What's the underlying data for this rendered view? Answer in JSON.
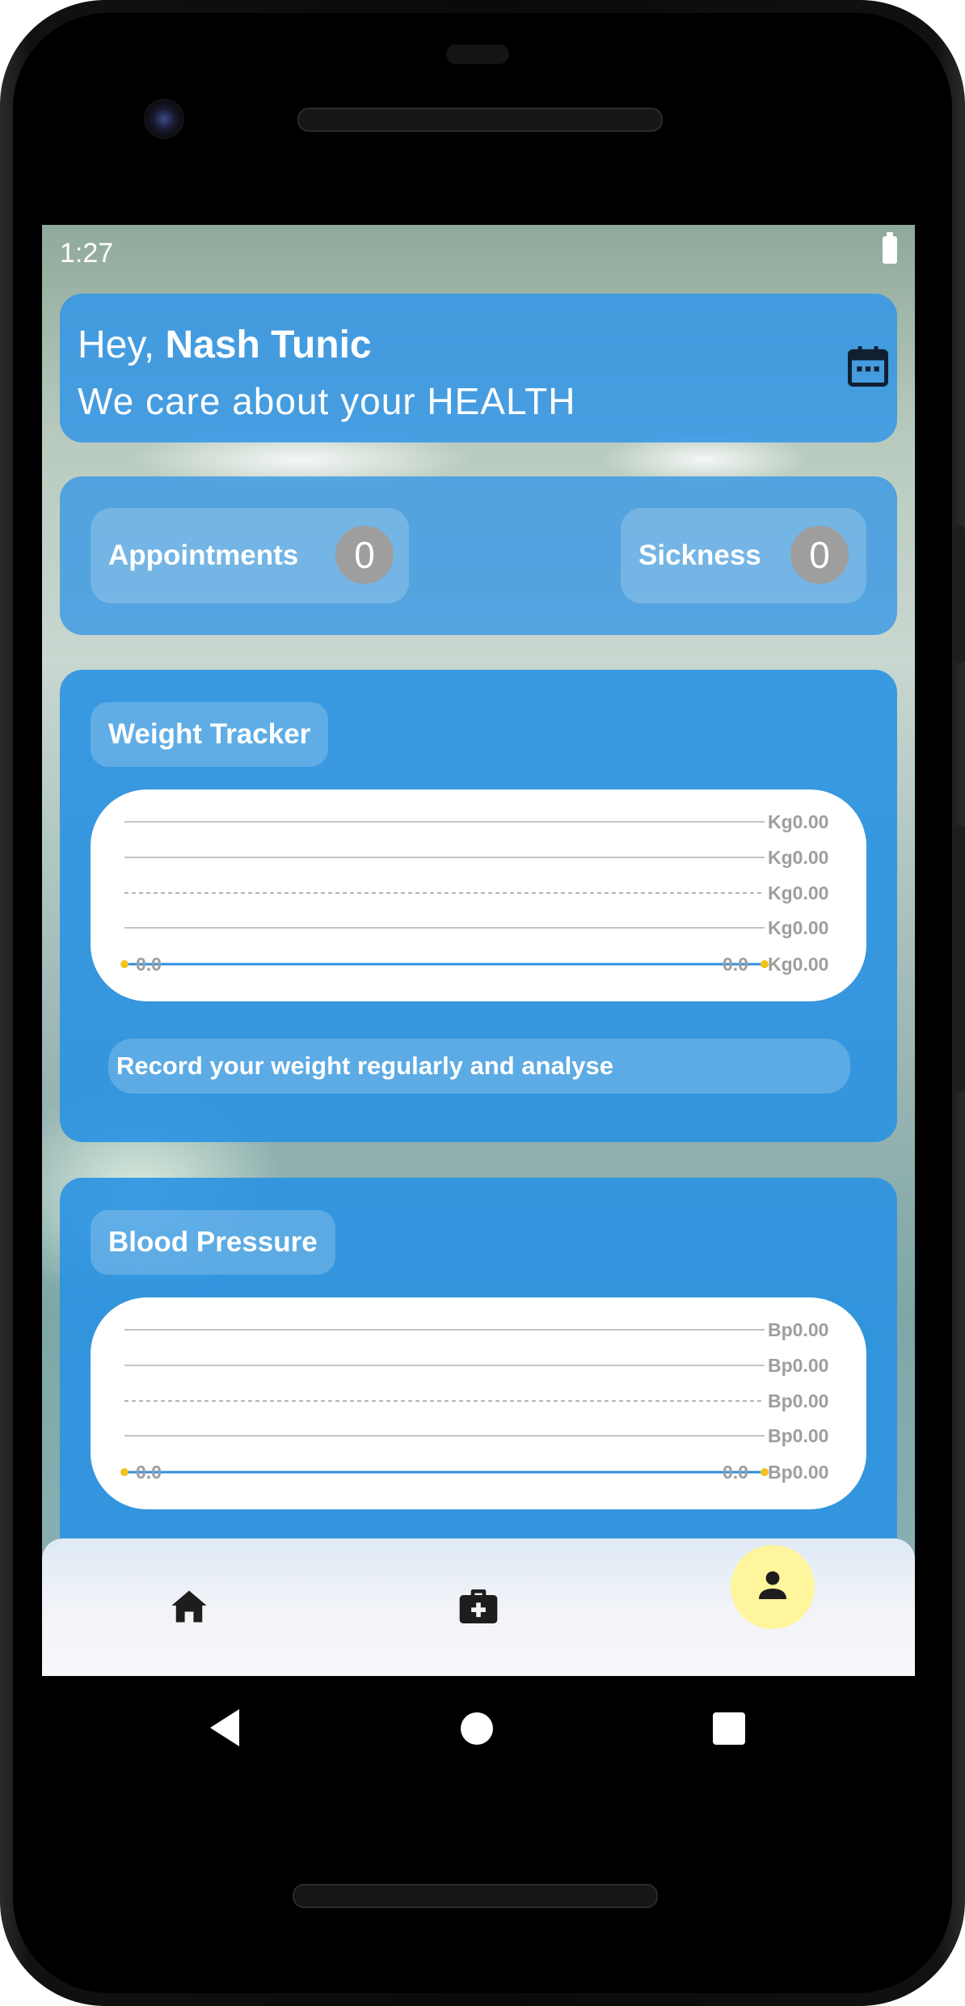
{
  "status_bar": {
    "time": "1:27"
  },
  "greeting": {
    "prefix": "Hey, ",
    "name": "Nash Tunic",
    "subtitle": "We care about your HEALTH",
    "calendar_icon": "calendar-icon"
  },
  "counts": {
    "appointments_label": "Appointments",
    "appointments_value": "0",
    "sickness_label": "Sickness",
    "sickness_value": "0"
  },
  "weight_tracker": {
    "title": "Weight Tracker",
    "note": "Record your weight regularly and analyse"
  },
  "blood_pressure": {
    "title": "Blood Pressure"
  },
  "chart_data": [
    {
      "type": "line",
      "title": "Weight Tracker",
      "x": [
        0,
        1
      ],
      "series": [
        {
          "values": [
            0.0,
            0.0
          ]
        }
      ],
      "point_labels": [
        "0.0",
        "0.0"
      ],
      "y_tick_labels": [
        "Kg0.00",
        "Kg0.00",
        "Kg0.00",
        "Kg0.00",
        "Kg0.00"
      ],
      "ylim": [
        0,
        0
      ],
      "grid": true,
      "line_color": "#2f8fe0",
      "point_color": "#f4c21f"
    },
    {
      "type": "line",
      "title": "Blood Pressure",
      "x": [
        0,
        1
      ],
      "series": [
        {
          "values": [
            0.0,
            0.0
          ]
        }
      ],
      "point_labels": [
        "0.0",
        "0.0"
      ],
      "y_tick_labels": [
        "Bp0.00",
        "Bp0.00",
        "Bp0.00",
        "Bp0.00",
        "Bp0.00"
      ],
      "ylim": [
        0,
        0
      ],
      "grid": true,
      "line_color": "#2f8fe0",
      "point_color": "#f4c21f"
    }
  ],
  "bottom_nav": {
    "items": [
      {
        "icon": "home-icon"
      },
      {
        "icon": "medical-kit-icon"
      },
      {
        "icon": "person-icon",
        "selected": true
      }
    ]
  },
  "colors": {
    "card_blue": "#3396e6",
    "selected_nav": "#fff59d",
    "badge_gray": "#9e9e9e"
  }
}
